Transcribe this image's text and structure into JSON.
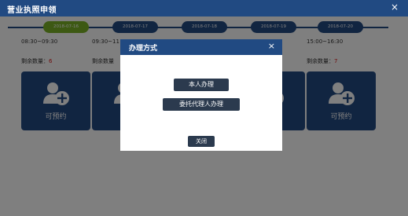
{
  "window": {
    "title": "营业执照申领",
    "close_glyph": "×"
  },
  "dates": [
    {
      "label": "2018-07-16",
      "active": true
    },
    {
      "label": "2018-07-17",
      "active": false
    },
    {
      "label": "2018-07-18",
      "active": false
    },
    {
      "label": "2018-07-19",
      "active": false
    },
    {
      "label": "2018-07-20",
      "active": false
    }
  ],
  "slots": [
    {
      "time": "08:30~09:30",
      "remain_label": "剩余数量：",
      "remain_value": "6",
      "status": "可预约"
    },
    {
      "time": "09:30~11",
      "remain_label": "剩余数量",
      "remain_value": "",
      "status": "可"
    },
    {
      "time": "",
      "remain_label": "",
      "remain_value": "",
      "status": ""
    },
    {
      "time": "",
      "remain_label": "",
      "remain_value": "",
      "status": ""
    },
    {
      "time": "15:00~16:30",
      "remain_label": "剩余数量：",
      "remain_value": "7",
      "status": "可预约"
    }
  ],
  "dialog": {
    "title": "办理方式",
    "close_glyph": "×",
    "self_button": "本人办理",
    "agent_button": "委托代理人办理",
    "close_button": "关闭"
  },
  "colors": {
    "brand": "#214a82",
    "active_date": "#7bb327",
    "remain_number": "#e02020",
    "dialog_button": "#2b3a4e"
  },
  "icons": {
    "slot": "add-user-icon",
    "close": "close-icon"
  }
}
